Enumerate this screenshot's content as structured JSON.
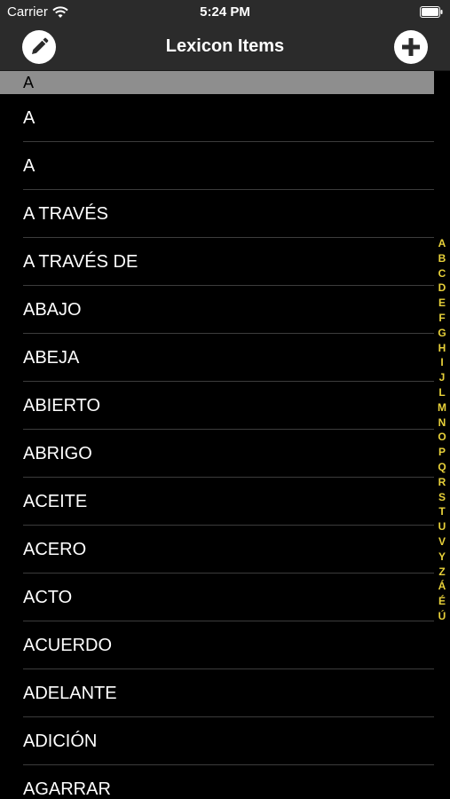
{
  "status_bar": {
    "carrier": "Carrier",
    "time": "5:24 PM"
  },
  "nav": {
    "title": "Lexicon Items",
    "left_icon": "pencil-icon",
    "right_icon": "plus-icon"
  },
  "section": {
    "header": "A"
  },
  "items": [
    {
      "label": "A"
    },
    {
      "label": "A"
    },
    {
      "label": "A TRAVÉS"
    },
    {
      "label": "A TRAVÉS DE"
    },
    {
      "label": "ABAJO"
    },
    {
      "label": "ABEJA"
    },
    {
      "label": "ABIERTO"
    },
    {
      "label": "ABRIGO"
    },
    {
      "label": "ACEITE"
    },
    {
      "label": "ACERO"
    },
    {
      "label": "ACTO"
    },
    {
      "label": "ACUERDO"
    },
    {
      "label": "ADELANTE"
    },
    {
      "label": "ADICIÓN"
    },
    {
      "label": "AGARRAR"
    }
  ],
  "index_letters": [
    "A",
    "B",
    "C",
    "D",
    "E",
    "F",
    "G",
    "H",
    "I",
    "J",
    "L",
    "M",
    "N",
    "O",
    "P",
    "Q",
    "R",
    "S",
    "T",
    "U",
    "V",
    "Y",
    "Z",
    "Á",
    "É",
    "Ú"
  ],
  "colors": {
    "index_accent": "#e8d13a",
    "bar_background": "#2b2b2b",
    "section_header": "#8e8e8e"
  }
}
